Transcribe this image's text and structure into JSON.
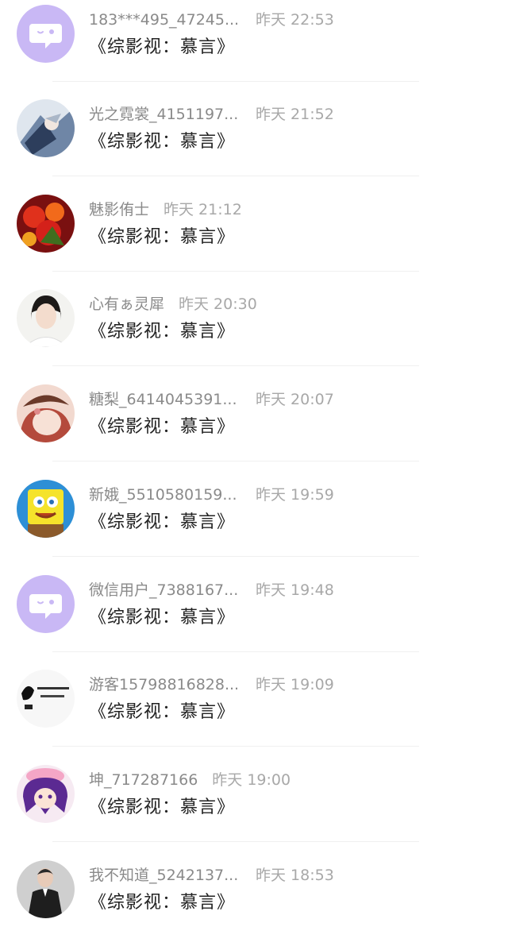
{
  "comments": [
    {
      "name": "183***495_47245...",
      "time": "昨天 22:53",
      "message": "《综影视：慕言》",
      "avatar": "default-purple-chat-icon",
      "truncated": true
    },
    {
      "name": "光之霓裳_4151197...",
      "time": "昨天 21:52",
      "message": "《综影视：慕言》",
      "avatar": "anime-figure-blue",
      "truncated": true
    },
    {
      "name": "魅影侑士",
      "time": "昨天 21:12",
      "message": "《综影视：慕言》",
      "avatar": "red-flowers",
      "truncated": false
    },
    {
      "name": "心有ぁ灵犀",
      "time": "昨天 20:30",
      "message": "《综影视：慕言》",
      "avatar": "girl-portrait",
      "truncated": false
    },
    {
      "name": "糖梨_6414045391...",
      "time": "昨天 20:07",
      "message": "《综影视：慕言》",
      "avatar": "anime-girl-hat",
      "truncated": true
    },
    {
      "name": "新娥_5510580159...",
      "time": "昨天 19:59",
      "message": "《综影视：慕言》",
      "avatar": "sponge-character",
      "truncated": true
    },
    {
      "name": "微信用户_7388167...",
      "time": "昨天 19:48",
      "message": "《综影视：慕言》",
      "avatar": "default-purple-chat-icon",
      "truncated": true
    },
    {
      "name": "游客15798816828...",
      "time": "昨天 19:09",
      "message": "《综影视：慕言》",
      "avatar": "calligraphy-sketch",
      "truncated": true
    },
    {
      "name": "坤_717287166",
      "time": "昨天 19:00",
      "message": "《综影视：慕言》",
      "avatar": "purple-hair-chibi",
      "truncated": false
    },
    {
      "name": "我不知道_5242137...",
      "time": "昨天 18:53",
      "message": "《综影视：慕言》",
      "avatar": "man-in-suit",
      "truncated": true
    }
  ],
  "colors": {
    "name": "#8a8a8a",
    "time": "#a8a8a8",
    "message": "#222222",
    "default_avatar_bg": "#c9b8f5"
  }
}
